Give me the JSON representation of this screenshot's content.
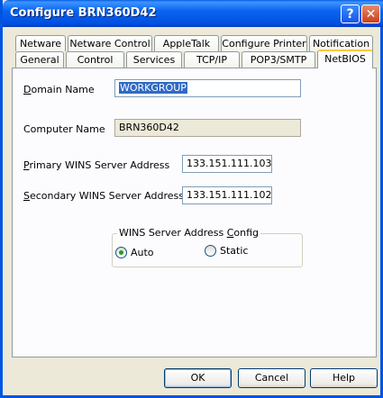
{
  "window": {
    "title": "Configure BRN360D42",
    "help_label": "?",
    "close_label": "✕"
  },
  "tabs": {
    "row1": [
      "Netware",
      "Netware Control",
      "AppleTalk",
      "Configure Printer",
      "Notification"
    ],
    "row2": [
      "General",
      "Control",
      "Services",
      "TCP/IP",
      "POP3/SMTP",
      "NetBIOS"
    ],
    "active": "NetBIOS"
  },
  "form": {
    "domain_name": {
      "label_first": "D",
      "label_rest": "omain Name",
      "value": "WORKGROUP"
    },
    "computer_name": {
      "label": "Computer Name",
      "value": "BRN360D42"
    },
    "primary_wins": {
      "label_first": "P",
      "label_rest": "rimary WINS Server Address",
      "value": "133.151.111.103"
    },
    "secondary_wins": {
      "label_first": "S",
      "label_rest": "econdary WINS Server Address",
      "value": "133.151.111.102"
    }
  },
  "wins_config": {
    "title_main": "WINS Server Address ",
    "title_underlined": "C",
    "title_rest": "onfig",
    "options": [
      {
        "label": "Auto",
        "selected": true
      },
      {
        "label": "Static",
        "selected": false
      }
    ]
  },
  "buttons": {
    "ok": "OK",
    "cancel": "Cancel",
    "help": "Help"
  }
}
